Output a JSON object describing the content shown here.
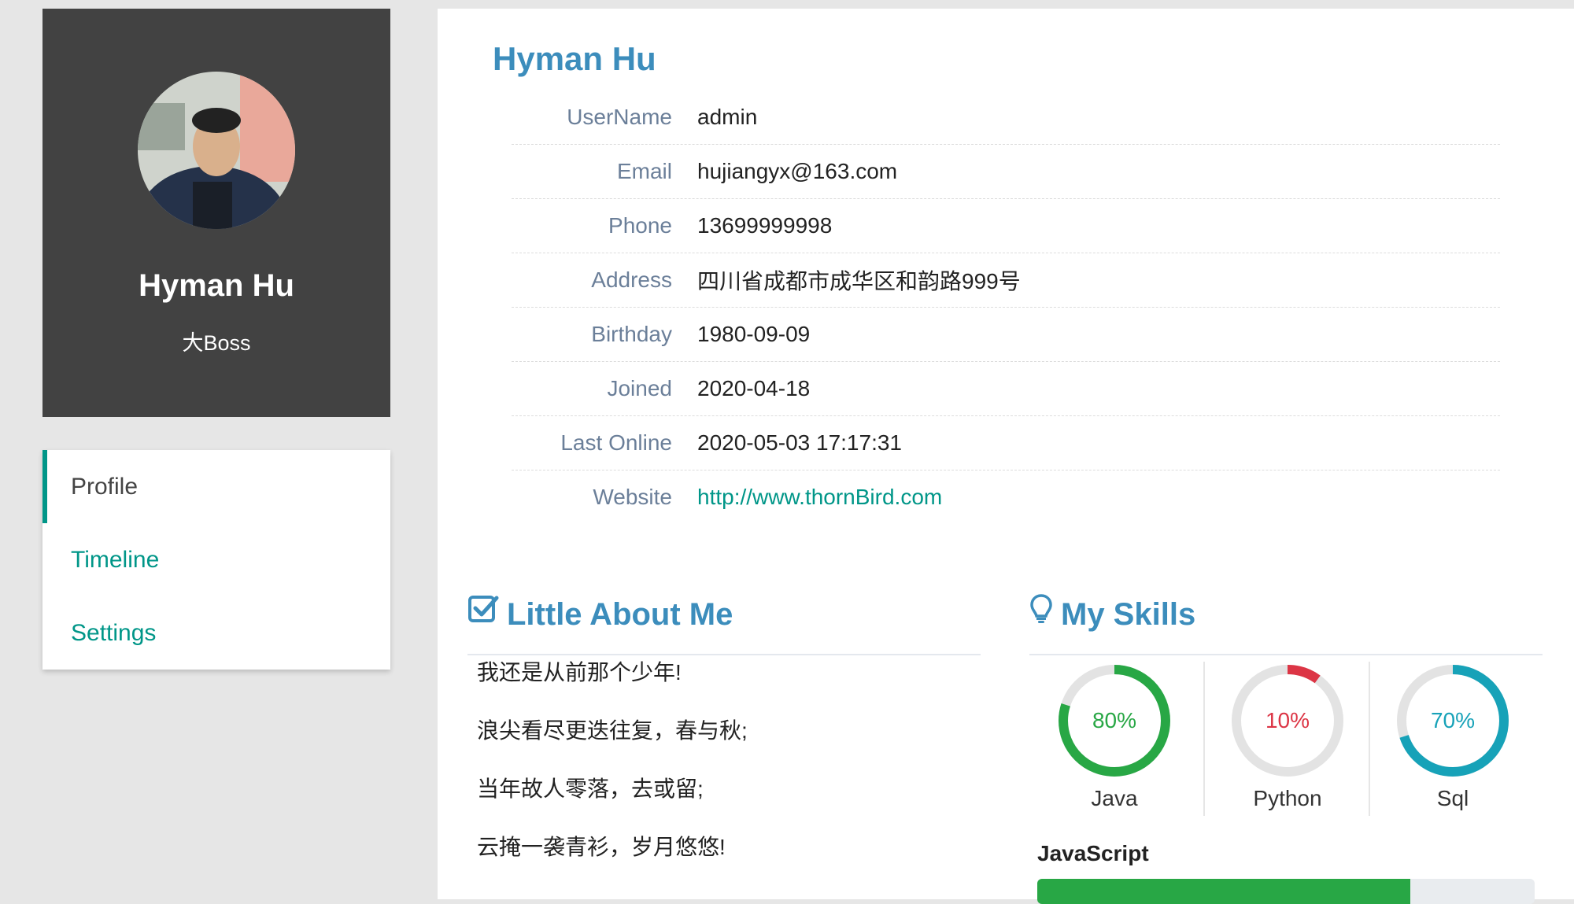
{
  "profile": {
    "name": "Hyman Hu",
    "role": "大Boss"
  },
  "menu": {
    "items": [
      {
        "label": "Profile"
      },
      {
        "label": "Timeline"
      },
      {
        "label": "Settings"
      }
    ]
  },
  "main": {
    "title": "Hyman Hu",
    "fields": [
      {
        "label": "UserName",
        "value": "admin"
      },
      {
        "label": "Email",
        "value": "hujiangyx@163.com"
      },
      {
        "label": "Phone",
        "value": "13699999998"
      },
      {
        "label": "Address",
        "value": "四川省成都市成华区和韵路999号"
      },
      {
        "label": "Birthday",
        "value": "1980-09-09"
      },
      {
        "label": "Joined",
        "value": "2020-04-18"
      },
      {
        "label": "Last Online",
        "value": "2020-05-03 17:17:31"
      },
      {
        "label": "Website",
        "value": "http://www.thornBird.com"
      }
    ]
  },
  "about": {
    "title": "Little About Me",
    "lines": [
      "我还是从前那个少年!",
      "浪尖看尽更迭往复，春与秋;",
      "当年故人零落，去或留;",
      "云掩一袭青衫，岁月悠悠!"
    ]
  },
  "skills": {
    "title": "My Skills",
    "donuts": [
      {
        "name": "Java",
        "percent": 80,
        "percent_label": "80%",
        "color": "#28a745"
      },
      {
        "name": "Python",
        "percent": 10,
        "percent_label": "10%",
        "color": "#dc3545"
      },
      {
        "name": "Sql",
        "percent": 70,
        "percent_label": "70%",
        "color": "#17a2b8"
      }
    ],
    "bar": {
      "name": "JavaScript",
      "percent": 75,
      "color": "#28a745"
    }
  }
}
